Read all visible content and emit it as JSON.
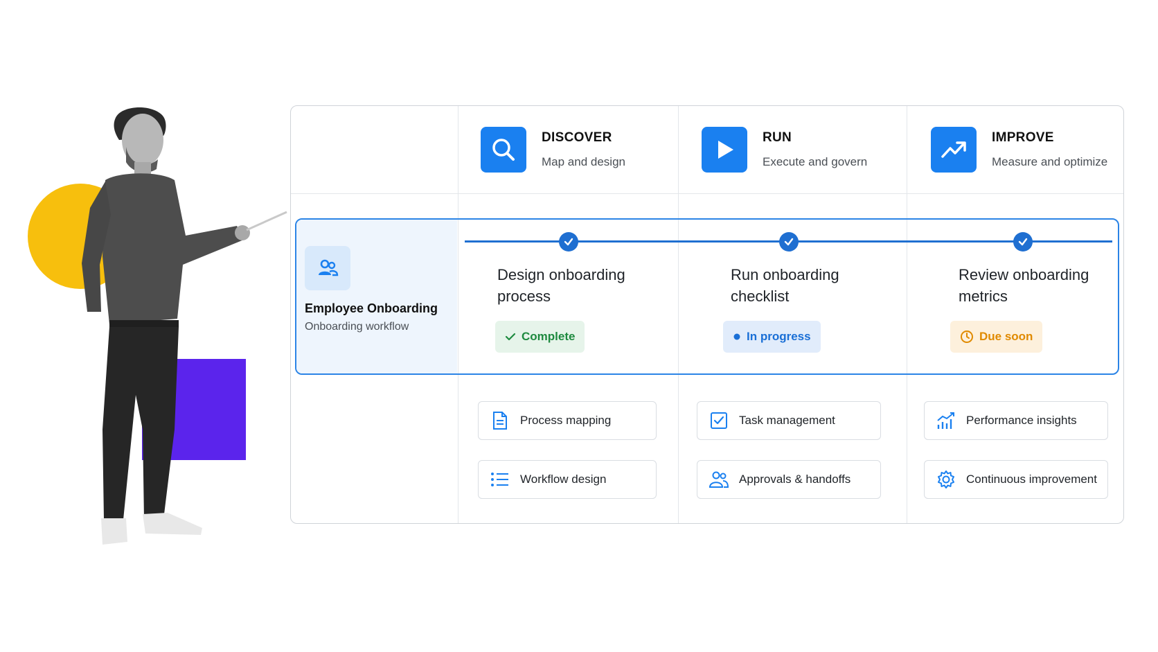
{
  "colors": {
    "accent": "#1a80f0",
    "track": "#1f6fd1",
    "complete": "#1e8a3f",
    "in_progress": "#1a6fd6",
    "due_soon": "#e08a00",
    "deco_yellow": "#f7bf0d",
    "deco_purple": "#5b24ec"
  },
  "phases": [
    {
      "title": "DISCOVER",
      "subtitle": "Map and design",
      "icon": "search-icon"
    },
    {
      "title": "RUN",
      "subtitle": "Execute and govern",
      "icon": "play-icon"
    },
    {
      "title": "IMPROVE",
      "subtitle": "Measure and optimize",
      "icon": "trending-up-icon"
    }
  ],
  "process": {
    "title": "Employee Onboarding",
    "subtitle": "Onboarding workflow",
    "icon": "users-icon",
    "steps": [
      {
        "title": "Design onboarding process",
        "status": "Complete",
        "status_icon": "check-icon"
      },
      {
        "title": "Run onboarding checklist",
        "status": "In progress",
        "status_icon": "dot-icon"
      },
      {
        "title": "Review onboarding metrics",
        "status": "Due soon",
        "status_icon": "clock-icon"
      }
    ]
  },
  "capabilities": [
    [
      {
        "label": "Process mapping",
        "icon": "document-icon"
      },
      {
        "label": "Workflow design",
        "icon": "list-icon"
      }
    ],
    [
      {
        "label": "Task management",
        "icon": "checkbox-icon"
      },
      {
        "label": "Approvals & handoffs",
        "icon": "users-icon"
      }
    ],
    [
      {
        "label": "Performance insights",
        "icon": "chart-icon"
      },
      {
        "label": "Continuous improvement",
        "icon": "gear-icon"
      }
    ]
  ]
}
